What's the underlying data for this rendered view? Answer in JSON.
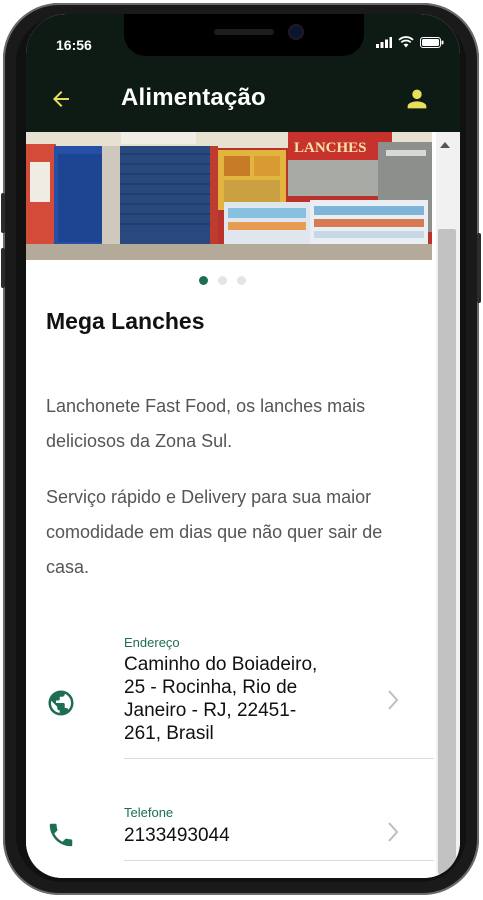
{
  "status_bar": {
    "time": "16:56"
  },
  "app_bar": {
    "title": "Alimentação"
  },
  "carousel": {
    "page_count": 3,
    "active_index": 0
  },
  "place": {
    "name": "Mega Lanches",
    "description_1": "Lanchonete Fast Food, os lanches mais deliciosos da Zona Sul.",
    "description_2": "Serviço rápido e Delivery para sua maior comodidade em dias que não quer sair de casa."
  },
  "address": {
    "label": "Endereço",
    "line1": "Caminho do Boiadeiro,",
    "line2": "25 - Rocinha, Rio de",
    "line3": "Janeiro - RJ, 22451-",
    "line4": "261, Brasil"
  },
  "phone": {
    "label": "Telefone",
    "value": "2133493044"
  },
  "colors": {
    "app_bar": "#0d1b14",
    "accent": "#1e6e52",
    "icon_yellow": "#e8e05a"
  },
  "icons": [
    "back-arrow-icon",
    "person-icon",
    "globe-icon",
    "phone-icon",
    "chevron-right-icon"
  ]
}
